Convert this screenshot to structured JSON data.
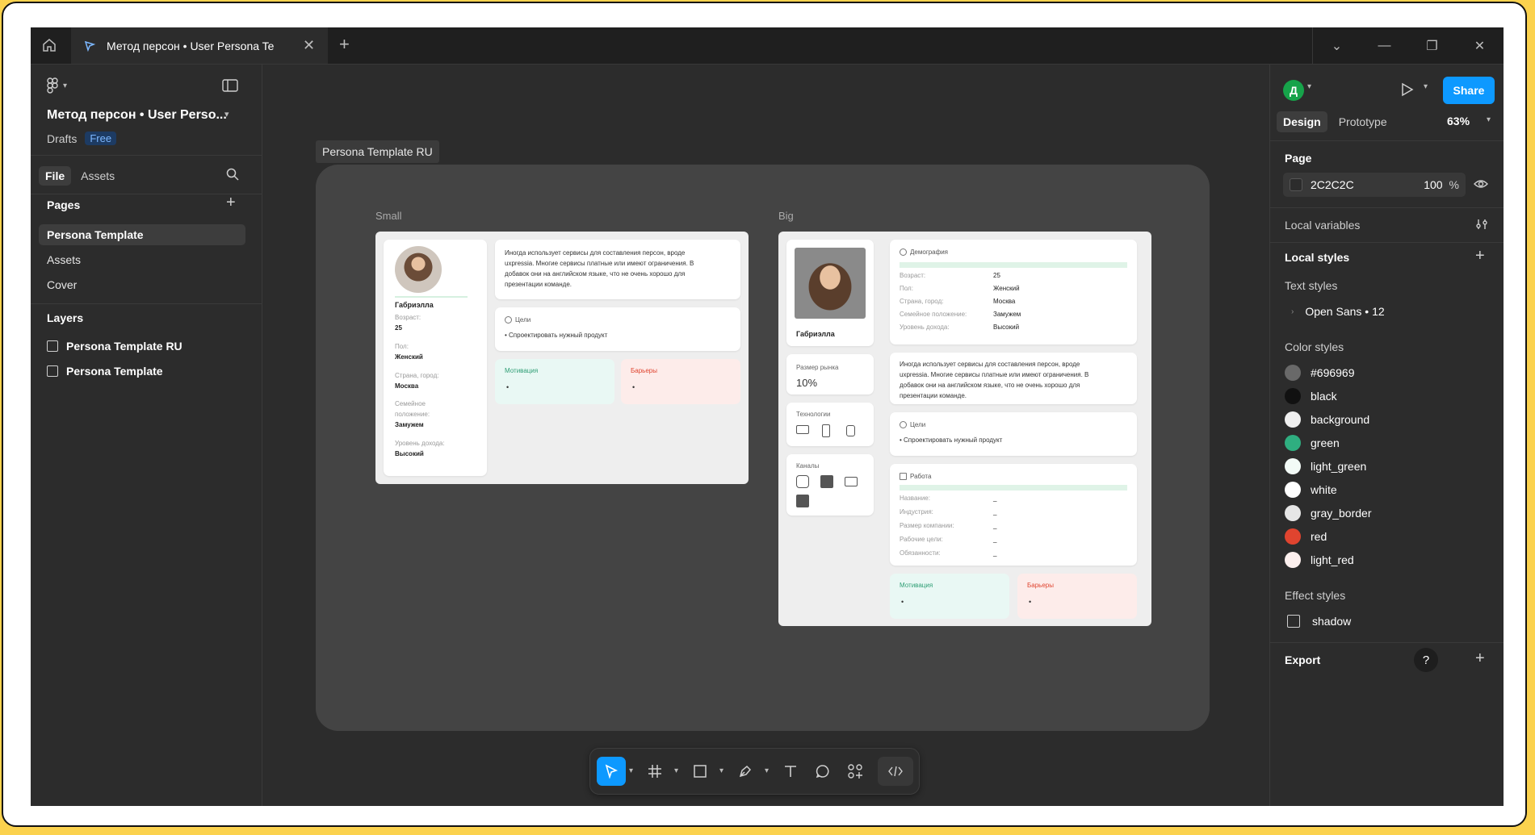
{
  "titlebar": {
    "tab_title": "Метод персон • User Persona Te"
  },
  "left_panel": {
    "file_title": "Метод персон • User Perso...",
    "drafts_label": "Drafts",
    "plan_badge": "Free",
    "tabs": [
      "File",
      "Assets"
    ],
    "pages_heading": "Pages",
    "pages": [
      "Persona Template",
      "Assets",
      "Cover"
    ],
    "layers_heading": "Layers",
    "layers": [
      "Persona Template RU",
      "Persona Template"
    ]
  },
  "canvas": {
    "frame_label": "Persona Template RU",
    "variants": [
      "Small",
      "Big"
    ],
    "persona": {
      "name": "Габриэлла",
      "age_label": "Возраст:",
      "age": "25",
      "gender_label": "Пол:",
      "gender": "Женский",
      "location_label": "Страна, город:",
      "location": "Москва",
      "marital_label_1": "Семейное",
      "marital_label_2": "положение:",
      "marital_label": "Семейное положение:",
      "marital": "Замужем",
      "income_label": "Уровень дохода:",
      "income": "Высокий",
      "quote_lines": [
        "Иногда использует сервисы для составления персон, вроде",
        "uxpressia. Многие сервисы платные или имеют ограничения. В",
        "добавок они на английском языке, что не очень хорошо для",
        "презентации команде."
      ],
      "goals_title": "Цели",
      "goal": "• Спроектировать нужный продукт",
      "motivation_title": "Мотивация",
      "barriers_title": "Барьеры",
      "bullet": "•",
      "demography_title": "Демография",
      "market_label": "Размер рынка",
      "market_value": "10%",
      "tech_label": "Технологии",
      "channels_label": "Каналы",
      "work_title": "Работа",
      "work_fields": [
        "Название:",
        "Индустрия:",
        "Размер компании:",
        "Рабочие цели:",
        "Обязанности:"
      ],
      "work_value": "_"
    }
  },
  "right_panel": {
    "avatar_letter": "Д",
    "share_label": "Share",
    "tabs": [
      "Design",
      "Prototype"
    ],
    "zoom": "63%",
    "page_heading": "Page",
    "page_color": "2C2C2C",
    "page_opacity": "100",
    "percent": "%",
    "local_variables": "Local variables",
    "local_styles": "Local styles",
    "text_styles_heading": "Text styles",
    "text_style": "Open Sans • 12",
    "color_styles_heading": "Color styles",
    "color_styles": [
      {
        "name": "#696969",
        "color": "#696969"
      },
      {
        "name": "black",
        "color": "#111111"
      },
      {
        "name": "background",
        "color": "#f0f0f0"
      },
      {
        "name": "green",
        "color": "#2fae80"
      },
      {
        "name": "light_green",
        "color": "#f3fbf7"
      },
      {
        "name": "white",
        "color": "#ffffff"
      },
      {
        "name": "gray_border",
        "color": "#e6e6e6"
      },
      {
        "name": "red",
        "color": "#e0442f"
      },
      {
        "name": "light_red",
        "color": "#fdf0ee"
      }
    ],
    "effect_styles_heading": "Effect styles",
    "effect_style": "shadow",
    "export_heading": "Export",
    "help": "?"
  },
  "colors": {
    "accent": "#0d99ff",
    "canvas": "#2c2c2c"
  }
}
